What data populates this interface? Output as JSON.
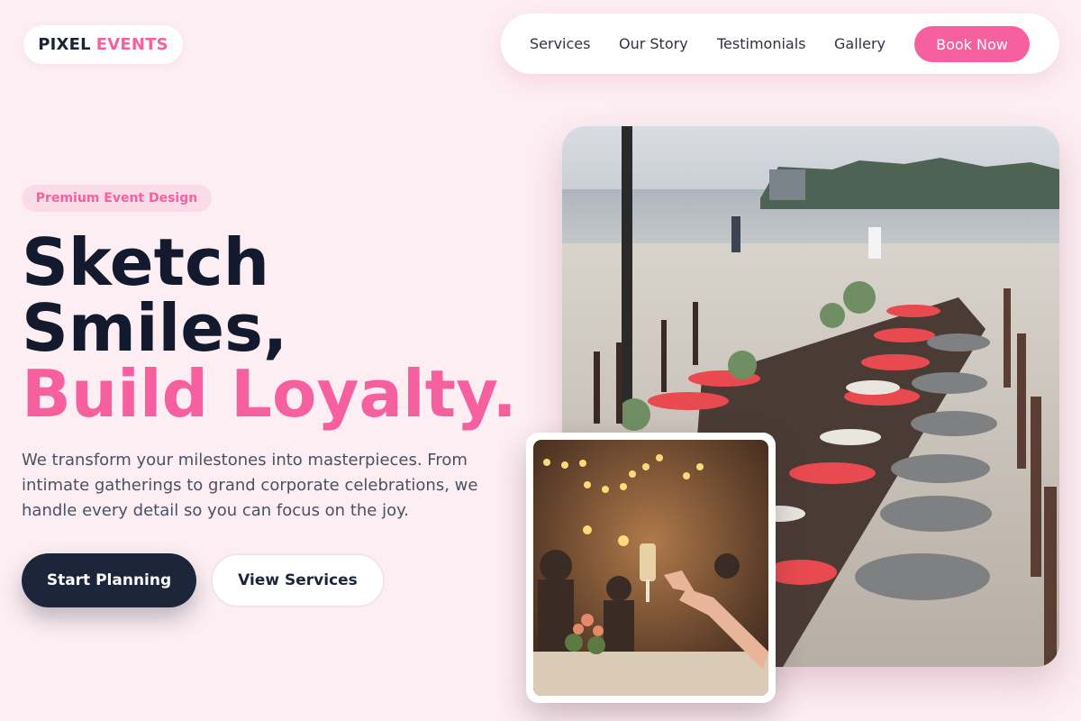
{
  "brand": {
    "name_part1": "PIXEL",
    "name_part2": "EVENTS",
    "primary_color": "#f7609f",
    "dark_color": "#1c253a",
    "background_color": "#fdeef3"
  },
  "nav": {
    "links": [
      {
        "label": "Services"
      },
      {
        "label": "Our Story"
      },
      {
        "label": "Testimonials"
      },
      {
        "label": "Gallery"
      }
    ],
    "cta_label": "Book Now"
  },
  "hero": {
    "badge": "Premium Event Design",
    "headline_line1": "Sketch",
    "headline_line2": "Smiles,",
    "headline_line3": "Build Loyalty.",
    "description": "We transform your milestones into masterpieces. From intimate gatherings to grand corporate celebrations, we handle every detail so you can focus on the joy.",
    "primary_button": "Start Planning",
    "secondary_button": "View Services"
  },
  "images": {
    "main": "beach-dinner-table-photo",
    "inset": "celebration-toast-photo"
  }
}
